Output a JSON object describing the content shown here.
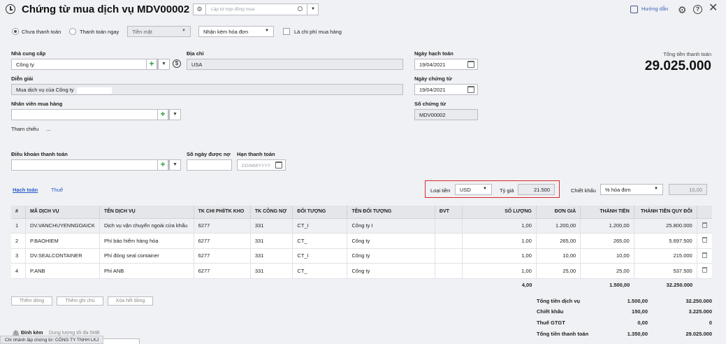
{
  "header": {
    "title": "Chứng từ mua dịch vụ MDV00002",
    "search_placeholder": "Lập từ hợp đồng mua",
    "help_link": "Hướng dẫn"
  },
  "options": {
    "radio_unpaid": "Chưa thanh toán",
    "radio_paid": "Thanh toán ngay",
    "payment_method": "Tiền mặt",
    "invoice_option": "Nhận kèm hóa đơn",
    "purchase_cost_checkbox": "Là chi phí mua hàng"
  },
  "form": {
    "supplier_label": "Nhà cung cấp",
    "supplier_value": "Công ty",
    "address_label": "Địa chỉ",
    "address_value": "USA",
    "description_label": "Diễn giải",
    "description_value": "Mua dịch vụ của Công ty",
    "employee_label": "Nhân viên mua hàng",
    "reference_label": "Tham chiếu",
    "reference_value": "...",
    "payment_terms_label": "Điều khoản thanh toán",
    "days_owed_label": "Số ngày được nợ",
    "due_date_label": "Hạn thanh toán",
    "due_date_placeholder": "DD/MM/YYYY",
    "posting_date_label": "Ngày hạch toán",
    "posting_date_value": "19/04/2021",
    "voucher_date_label": "Ngày chứng từ",
    "voucher_date_value": "19/04/2021",
    "voucher_no_label": "Số chứng từ",
    "voucher_no_value": "MDV00002"
  },
  "total": {
    "label": "Tổng tiền thanh toán",
    "value": "29.025.000"
  },
  "tabs": {
    "accounting": "Hạch toán",
    "tax": "Thuế"
  },
  "currency": {
    "label": "Loại tiền",
    "value": "USD",
    "rate_label": "Tỷ giá",
    "rate_value": "21.500"
  },
  "discount": {
    "label": "Chiết khấu",
    "type": "% hóa đơn",
    "value": "10,00"
  },
  "table": {
    "columns": [
      "#",
      "MÃ DỊCH VỤ",
      "TÊN DỊCH VỤ",
      "TK CHI PHÍ/TK KHO",
      "TK CÔNG NỢ",
      "ĐỐI TƯỢNG",
      "TÊN ĐỐI TƯỢNG",
      "ĐVT",
      "SỐ LƯỢNG",
      "ĐƠN GIÁ",
      "THÀNH TIỀN",
      "THÀNH TIỀN QUY ĐỔI"
    ],
    "rows": [
      [
        "1",
        "DV.VANCHUYENNGOAICK",
        "Dịch vụ vận chuyển ngoài cửa khẩu",
        "6277",
        "331",
        "CT_I",
        "Công ty I",
        "",
        "1,00",
        "1.200,00",
        "1.200,00",
        "25.800.000"
      ],
      [
        "2",
        "P.BAOHIEM",
        "Phí bảo hiểm hàng hóa",
        "6277",
        "331",
        "CT_",
        "Công ty",
        "",
        "1,00",
        "265,00",
        "265,00",
        "5.697.500"
      ],
      [
        "3",
        "DV.SEALCONTAINER",
        "Phí đóng seal container",
        "6277",
        "331",
        "CT_I",
        "Công ty",
        "",
        "1,00",
        "10,00",
        "10,00",
        "215.000"
      ],
      [
        "4",
        "P.ANB",
        "Phí ANB",
        "6277",
        "331",
        "CT_",
        "Công ty",
        "",
        "1,00",
        "25,00",
        "25,00",
        "537.500"
      ]
    ],
    "totals": {
      "quantity": "4,00",
      "amount": "1.500,00",
      "converted": "32.250.000"
    }
  },
  "buttons": {
    "add_row": "Thêm dòng",
    "add_note": "Thêm ghi chú",
    "delete_all": "Xóa hết dòng"
  },
  "summary": [
    {
      "label": "Tổng tiền dịch vụ",
      "amount": "1.500,00",
      "converted": "32.250.000"
    },
    {
      "label": "Chiết khấu",
      "amount": "150,00",
      "converted": "3.225.000"
    },
    {
      "label": "Thuế GTGT",
      "amount": "0,00",
      "converted": "0"
    },
    {
      "label": "Tổng tiền thanh toán",
      "amount": "1.350,00",
      "converted": "29.025.000"
    }
  ],
  "attachment": {
    "label": "Đính kèm",
    "hint": "Dung lượng tối đa 5MB"
  },
  "footer": {
    "branch": "Chi nhánh lập chứng từ: CÔNG TY TNHH LKJ"
  }
}
